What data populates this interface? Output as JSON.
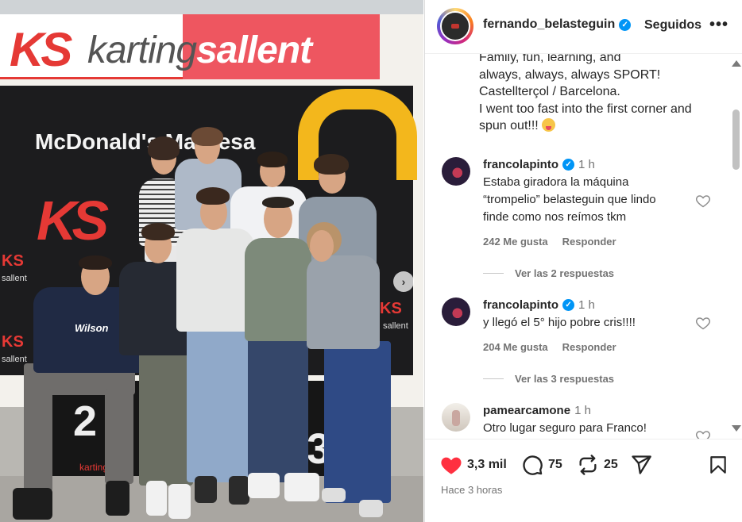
{
  "photo": {
    "banner_brand_light": "karting",
    "banner_brand_bold": "sallent",
    "banner_logo": "KS",
    "board_sponsor": "McDonald's Manresa",
    "side_logo": "KS",
    "side_small_text": "sallent",
    "podium_left": "2",
    "podium_right": "3",
    "podium_brand": "karting",
    "shirt_text": "Wilson",
    "carousel_next": "›"
  },
  "header": {
    "username": "fernando_belasteguin",
    "follow_label": "Seguidos",
    "more_label": "•••"
  },
  "caption": {
    "lines": [
      "Family, fun, learning, and",
      "always, always, always SPORT!",
      "Castellterçol / Barcelona.",
      "I went too fast into the first corner and",
      "spun out!!!"
    ]
  },
  "comments": [
    {
      "user": "francolapinto",
      "time": "1 h",
      "lines": [
        "Estaba giradora la máquina",
        "“trompelio” belasteguin que lindo",
        "finde como nos reímos tkm"
      ],
      "likes": "242 Me gusta",
      "reply": "Responder",
      "view_replies": "Ver las 2 respuestas"
    },
    {
      "user": "francolapinto",
      "time": "1 h",
      "lines": [
        "y llegó el 5° hijo pobre cris!!!!"
      ],
      "likes": "204 Me gusta",
      "reply": "Responder",
      "view_replies": "Ver las 3 respuestas"
    },
    {
      "user": "pamearcamone",
      "time": "1 h",
      "lines": [
        "Otro lugar seguro para Franco!"
      ]
    }
  ],
  "actions": {
    "likes": "3,3 mil",
    "comments": "75",
    "reposts": "25",
    "posted": "Hace 3 horas",
    "like_color": "#ff3040"
  }
}
